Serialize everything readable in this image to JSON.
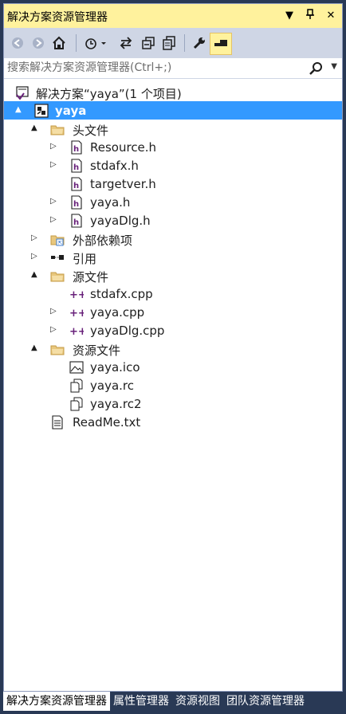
{
  "panel": {
    "title": "解决方案资源管理器",
    "title_buttons": [
      {
        "icon": "dropdown-arrow-icon",
        "glyph": "▼"
      },
      {
        "icon": "pin-icon",
        "glyph": "⊥"
      },
      {
        "icon": "close-icon",
        "glyph": "✕"
      }
    ]
  },
  "toolbar": {
    "items": [
      "back-icon",
      "forward-icon",
      "home-icon",
      "history-icon",
      "sync-icon",
      "collapse-all-icon",
      "show-all-files-icon",
      "properties-wrench-icon",
      "preview-icon"
    ]
  },
  "search": {
    "placeholder": "搜索解决方案资源管理器(Ctrl+;)"
  },
  "tree": [
    {
      "label": "解决方案“yaya”(1 个项目)",
      "icon": "solution-icon",
      "expander": "",
      "indent": 0
    },
    {
      "label": "yaya",
      "icon": "project-icon",
      "expander": "▲",
      "indent": 0,
      "selected": true
    },
    {
      "label": "头文件",
      "icon": "filter-folder-icon",
      "expander": "▲",
      "indent": 1
    },
    {
      "label": "Resource.h",
      "icon": "header-file-icon",
      "expander": "▷",
      "indent": 2
    },
    {
      "label": "stdafx.h",
      "icon": "header-file-icon",
      "expander": "▷",
      "indent": 2
    },
    {
      "label": "targetver.h",
      "icon": "header-file-icon",
      "expander": "",
      "indent": 2
    },
    {
      "label": "yaya.h",
      "icon": "header-file-icon",
      "expander": "▷",
      "indent": 2
    },
    {
      "label": "yayaDlg.h",
      "icon": "header-file-icon",
      "expander": "▷",
      "indent": 2
    },
    {
      "label": "外部依赖项",
      "icon": "external-deps-icon",
      "expander": "▷",
      "indent": 1
    },
    {
      "label": "引用",
      "icon": "references-icon",
      "expander": "▷",
      "indent": 1
    },
    {
      "label": "源文件",
      "icon": "filter-folder-icon",
      "expander": "▲",
      "indent": 1
    },
    {
      "label": "stdafx.cpp",
      "icon": "cpp-file-icon",
      "expander": "",
      "indent": 2
    },
    {
      "label": "yaya.cpp",
      "icon": "cpp-file-icon",
      "expander": "▷",
      "indent": 2
    },
    {
      "label": "yayaDlg.cpp",
      "icon": "cpp-file-icon",
      "expander": "▷",
      "indent": 2
    },
    {
      "label": "资源文件",
      "icon": "filter-folder-icon",
      "expander": "▲",
      "indent": 1
    },
    {
      "label": "yaya.ico",
      "icon": "image-file-icon",
      "expander": "",
      "indent": 2
    },
    {
      "label": "yaya.rc",
      "icon": "resource-file-icon",
      "expander": "",
      "indent": 2
    },
    {
      "label": "yaya.rc2",
      "icon": "resource-file-icon",
      "expander": "",
      "indent": 2
    },
    {
      "label": "ReadMe.txt",
      "icon": "text-file-icon",
      "expander": "",
      "indent": 1
    }
  ],
  "tabs": [
    {
      "label": "解决方案资源管理器",
      "active": true
    },
    {
      "label": "属性管理器",
      "active": false
    },
    {
      "label": "资源视图",
      "active": false
    },
    {
      "label": "团队资源管理器",
      "active": false
    }
  ],
  "colors": {
    "title_bg": "#fff29d",
    "toolbar_bg": "#cfd6e5",
    "selected_bg": "#3399ff",
    "frame_bg": "#293955"
  }
}
